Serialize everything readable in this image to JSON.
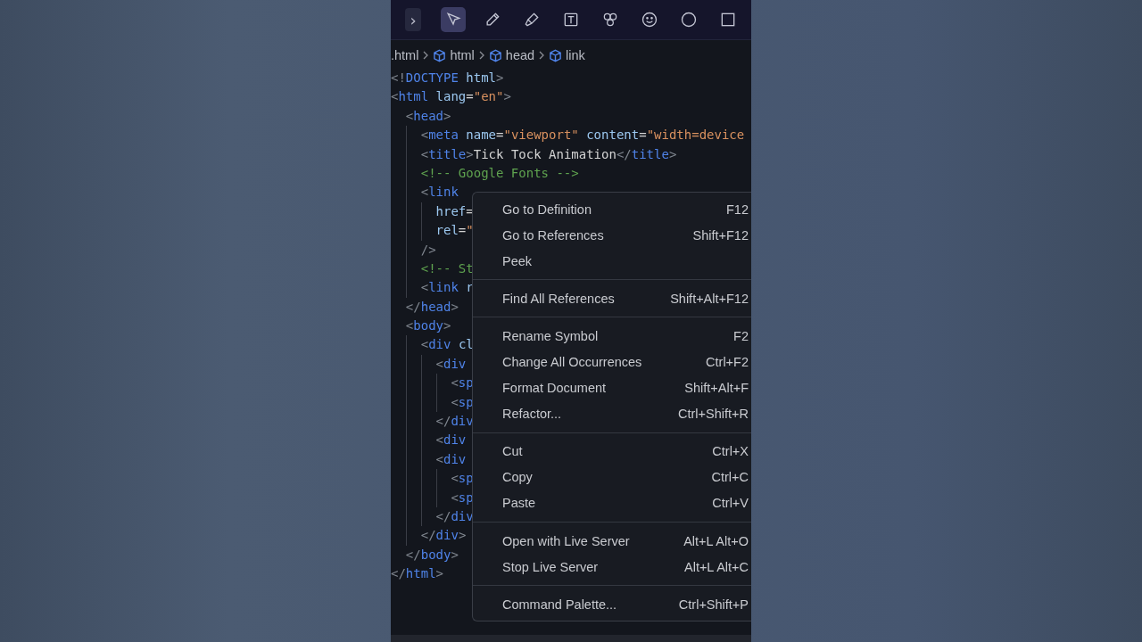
{
  "toolbar": {
    "expand_button": {
      "label": "›"
    },
    "tools": [
      {
        "selected": true
      },
      {
        "selected": false
      },
      {
        "selected": false
      },
      {
        "selected": false
      },
      {
        "selected": false
      },
      {
        "selected": false
      },
      {
        "selected": false
      },
      {
        "selected": false
      }
    ]
  },
  "breadcrumbs": [
    {
      "label": ".html",
      "kind": "file"
    },
    {
      "label": "html",
      "kind": "element"
    },
    {
      "label": "head",
      "kind": "element"
    },
    {
      "label": "link",
      "kind": "element"
    }
  ],
  "code_lines": [
    [
      {
        "kind": "punct",
        "text": "<!"
      },
      {
        "kind": "tag",
        "text": "DOCTYPE"
      },
      {
        "kind": "attr",
        "text": " html"
      },
      {
        "kind": "punct",
        "text": ">"
      }
    ],
    [
      {
        "kind": "punct",
        "text": "<"
      },
      {
        "kind": "tag",
        "text": "html"
      },
      {
        "kind": "attr",
        "text": " lang"
      },
      {
        "kind": "plain",
        "text": "="
      },
      {
        "kind": "string",
        "text": "\"en\""
      },
      {
        "kind": "punct",
        "text": ">"
      }
    ],
    [
      {
        "kind": "punct",
        "text": "  <"
      },
      {
        "kind": "tag",
        "text": "head"
      },
      {
        "kind": "punct",
        "text": ">"
      }
    ],
    [
      {
        "kind": "punct",
        "text": "    <"
      },
      {
        "kind": "tag",
        "text": "meta"
      },
      {
        "kind": "attr",
        "text": " name"
      },
      {
        "kind": "plain",
        "text": "="
      },
      {
        "kind": "string",
        "text": "\"viewport\""
      },
      {
        "kind": "attr",
        "text": " content"
      },
      {
        "kind": "plain",
        "text": "="
      },
      {
        "kind": "string",
        "text": "\"width=device"
      }
    ],
    [
      {
        "kind": "punct",
        "text": "    <"
      },
      {
        "kind": "tag",
        "text": "title"
      },
      {
        "kind": "punct",
        "text": ">"
      },
      {
        "kind": "plain",
        "text": "Tick Tock Animation"
      },
      {
        "kind": "punct",
        "text": "</"
      },
      {
        "kind": "tag",
        "text": "title"
      },
      {
        "kind": "punct",
        "text": ">"
      }
    ],
    [
      {
        "kind": "comment",
        "text": "    <!-- Google Fonts -->"
      }
    ],
    [
      {
        "kind": "punct",
        "text": "    <"
      },
      {
        "kind": "tag",
        "text": "link"
      }
    ],
    [
      {
        "kind": "attr",
        "text": "      href"
      },
      {
        "kind": "plain",
        "text": "="
      }
    ],
    [
      {
        "kind": "attr",
        "text": "      rel"
      },
      {
        "kind": "plain",
        "text": "="
      },
      {
        "kind": "string",
        "text": "\""
      }
    ],
    [
      {
        "kind": "punct",
        "text": "    />"
      }
    ],
    [
      {
        "kind": "comment",
        "text": "    <!-- St"
      }
    ],
    [
      {
        "kind": "punct",
        "text": "    <"
      },
      {
        "kind": "tag",
        "text": "link"
      },
      {
        "kind": "attr",
        "text": " r"
      }
    ],
    [
      {
        "kind": "punct",
        "text": "  </"
      },
      {
        "kind": "tag",
        "text": "head"
      },
      {
        "kind": "punct",
        "text": ">"
      }
    ],
    [
      {
        "kind": "punct",
        "text": "  <"
      },
      {
        "kind": "tag",
        "text": "body"
      },
      {
        "kind": "punct",
        "text": ">"
      }
    ],
    [
      {
        "kind": "punct",
        "text": "    <"
      },
      {
        "kind": "tag",
        "text": "div"
      },
      {
        "kind": "attr",
        "text": " cl"
      }
    ],
    [
      {
        "kind": "punct",
        "text": "      <"
      },
      {
        "kind": "tag",
        "text": "div"
      }
    ],
    [
      {
        "kind": "punct",
        "text": "        <"
      },
      {
        "kind": "tag",
        "text": "sp"
      }
    ],
    [
      {
        "kind": "punct",
        "text": "        <"
      },
      {
        "kind": "tag",
        "text": "sp"
      }
    ],
    [
      {
        "kind": "punct",
        "text": "      </"
      },
      {
        "kind": "tag",
        "text": "div"
      }
    ],
    [
      {
        "kind": "punct",
        "text": "      <"
      },
      {
        "kind": "tag",
        "text": "div"
      }
    ],
    [
      {
        "kind": "punct",
        "text": "      <"
      },
      {
        "kind": "tag",
        "text": "div"
      }
    ],
    [
      {
        "kind": "punct",
        "text": "        <"
      },
      {
        "kind": "tag",
        "text": "sp"
      }
    ],
    [
      {
        "kind": "punct",
        "text": "        <"
      },
      {
        "kind": "tag",
        "text": "sp"
      }
    ],
    [
      {
        "kind": "punct",
        "text": "      </"
      },
      {
        "kind": "tag",
        "text": "div"
      }
    ],
    [
      {
        "kind": "punct",
        "text": "    </"
      },
      {
        "kind": "tag",
        "text": "div"
      },
      {
        "kind": "punct",
        "text": ">"
      }
    ],
    [
      {
        "kind": "punct",
        "text": "  </"
      },
      {
        "kind": "tag",
        "text": "body"
      },
      {
        "kind": "punct",
        "text": ">"
      }
    ],
    [
      {
        "kind": "punct",
        "text": "</"
      },
      {
        "kind": "tag",
        "text": "html"
      },
      {
        "kind": "punct",
        "text": ">"
      }
    ]
  ],
  "context_menu": {
    "groups": [
      [
        {
          "label": "Go to Definition",
          "shortcut": "F12"
        },
        {
          "label": "Go to References",
          "shortcut": "Shift+F12"
        },
        {
          "label": "Peek"
        }
      ],
      [
        {
          "label": "Find All References",
          "shortcut": "Shift+Alt+F12"
        }
      ],
      [
        {
          "label": "Rename Symbol",
          "shortcut": "F2"
        },
        {
          "label": "Change All Occurrences",
          "shortcut": "Ctrl+F2"
        },
        {
          "label": "Format Document",
          "shortcut": "Shift+Alt+F"
        },
        {
          "label": "Refactor...",
          "shortcut": "Ctrl+Shift+R"
        }
      ],
      [
        {
          "label": "Cut",
          "shortcut": "Ctrl+X"
        },
        {
          "label": "Copy",
          "shortcut": "Ctrl+C"
        },
        {
          "label": "Paste",
          "shortcut": "Ctrl+V"
        }
      ],
      [
        {
          "label": "Open with Live Server",
          "shortcut": "Alt+L Alt+O"
        },
        {
          "label": "Stop Live Server",
          "shortcut": "Alt+L Alt+C"
        }
      ],
      [
        {
          "label": "Command Palette...",
          "shortcut": "Ctrl+Shift+P"
        }
      ]
    ]
  }
}
